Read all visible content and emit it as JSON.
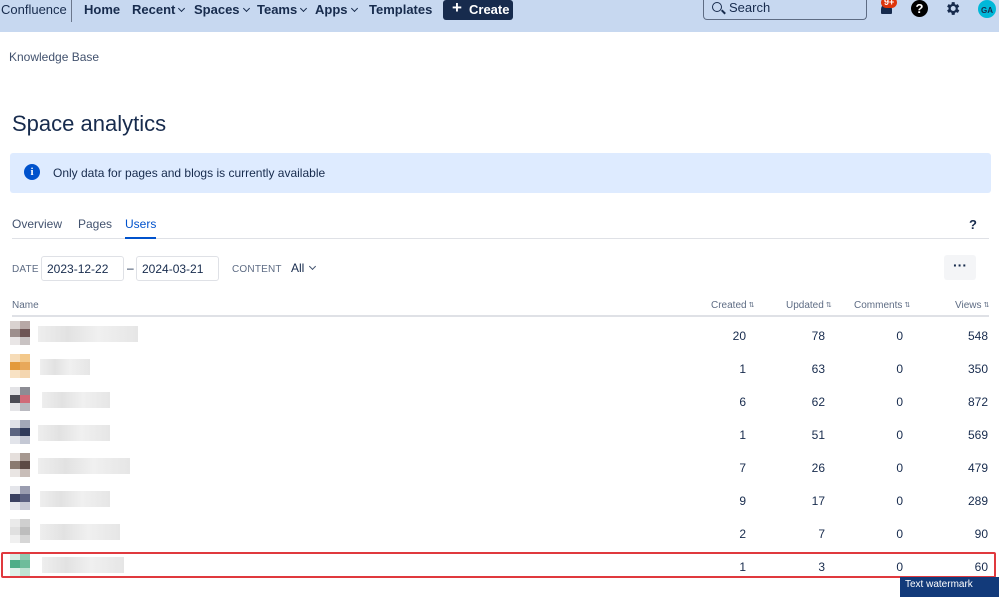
{
  "topnav": {
    "brand": "Confluence",
    "items": [
      {
        "label": "Home",
        "dropdown": false
      },
      {
        "label": "Recent",
        "dropdown": true
      },
      {
        "label": "Spaces",
        "dropdown": true
      },
      {
        "label": "Teams",
        "dropdown": true
      },
      {
        "label": "Apps",
        "dropdown": true
      },
      {
        "label": "Templates",
        "dropdown": false
      }
    ],
    "create_label": "Create",
    "search_placeholder": "Search",
    "notification_badge": "9+",
    "help_glyph": "?",
    "avatar_initials": "GA",
    "icons": [
      "search-icon",
      "bell-icon",
      "help-icon",
      "gear-icon"
    ]
  },
  "breadcrumb": "Knowledge Base",
  "page_title": "Space analytics",
  "info_banner": {
    "icon": "info-icon",
    "text": "Only data for pages and blogs is currently available"
  },
  "tabs": [
    {
      "label": "Overview",
      "active": false
    },
    {
      "label": "Pages",
      "active": false
    },
    {
      "label": "Users",
      "active": true
    }
  ],
  "tab_help": "?",
  "filters": {
    "date_label": "DATE",
    "date_from": "2023-12-22",
    "date_separator": "–",
    "date_to": "2024-03-21",
    "content_label": "CONTENT",
    "content_value": "All",
    "more_label": "···"
  },
  "table": {
    "columns": [
      "Name",
      "Created",
      "Updated",
      "Comments",
      "Views"
    ],
    "rows": [
      {
        "created": "20",
        "updated": "78",
        "comments": "0",
        "views": "548"
      },
      {
        "created": "1",
        "updated": "63",
        "comments": "0",
        "views": "350"
      },
      {
        "created": "6",
        "updated": "62",
        "comments": "0",
        "views": "872"
      },
      {
        "created": "1",
        "updated": "51",
        "comments": "0",
        "views": "569"
      },
      {
        "created": "7",
        "updated": "26",
        "comments": "0",
        "views": "479"
      },
      {
        "created": "9",
        "updated": "17",
        "comments": "0",
        "views": "289"
      },
      {
        "created": "2",
        "updated": "7",
        "comments": "0",
        "views": "90"
      },
      {
        "created": "1",
        "updated": "3",
        "comments": "0",
        "views": "60"
      }
    ],
    "highlighted_row_index": 7
  },
  "watermark": "Text watermark",
  "colors": {
    "nav_bg": "#c7d8f0",
    "text": "#172b4d",
    "link_active": "#0052cc",
    "banner_bg": "#deebff",
    "highlight": "#e0393e",
    "badge": "#de350b"
  }
}
